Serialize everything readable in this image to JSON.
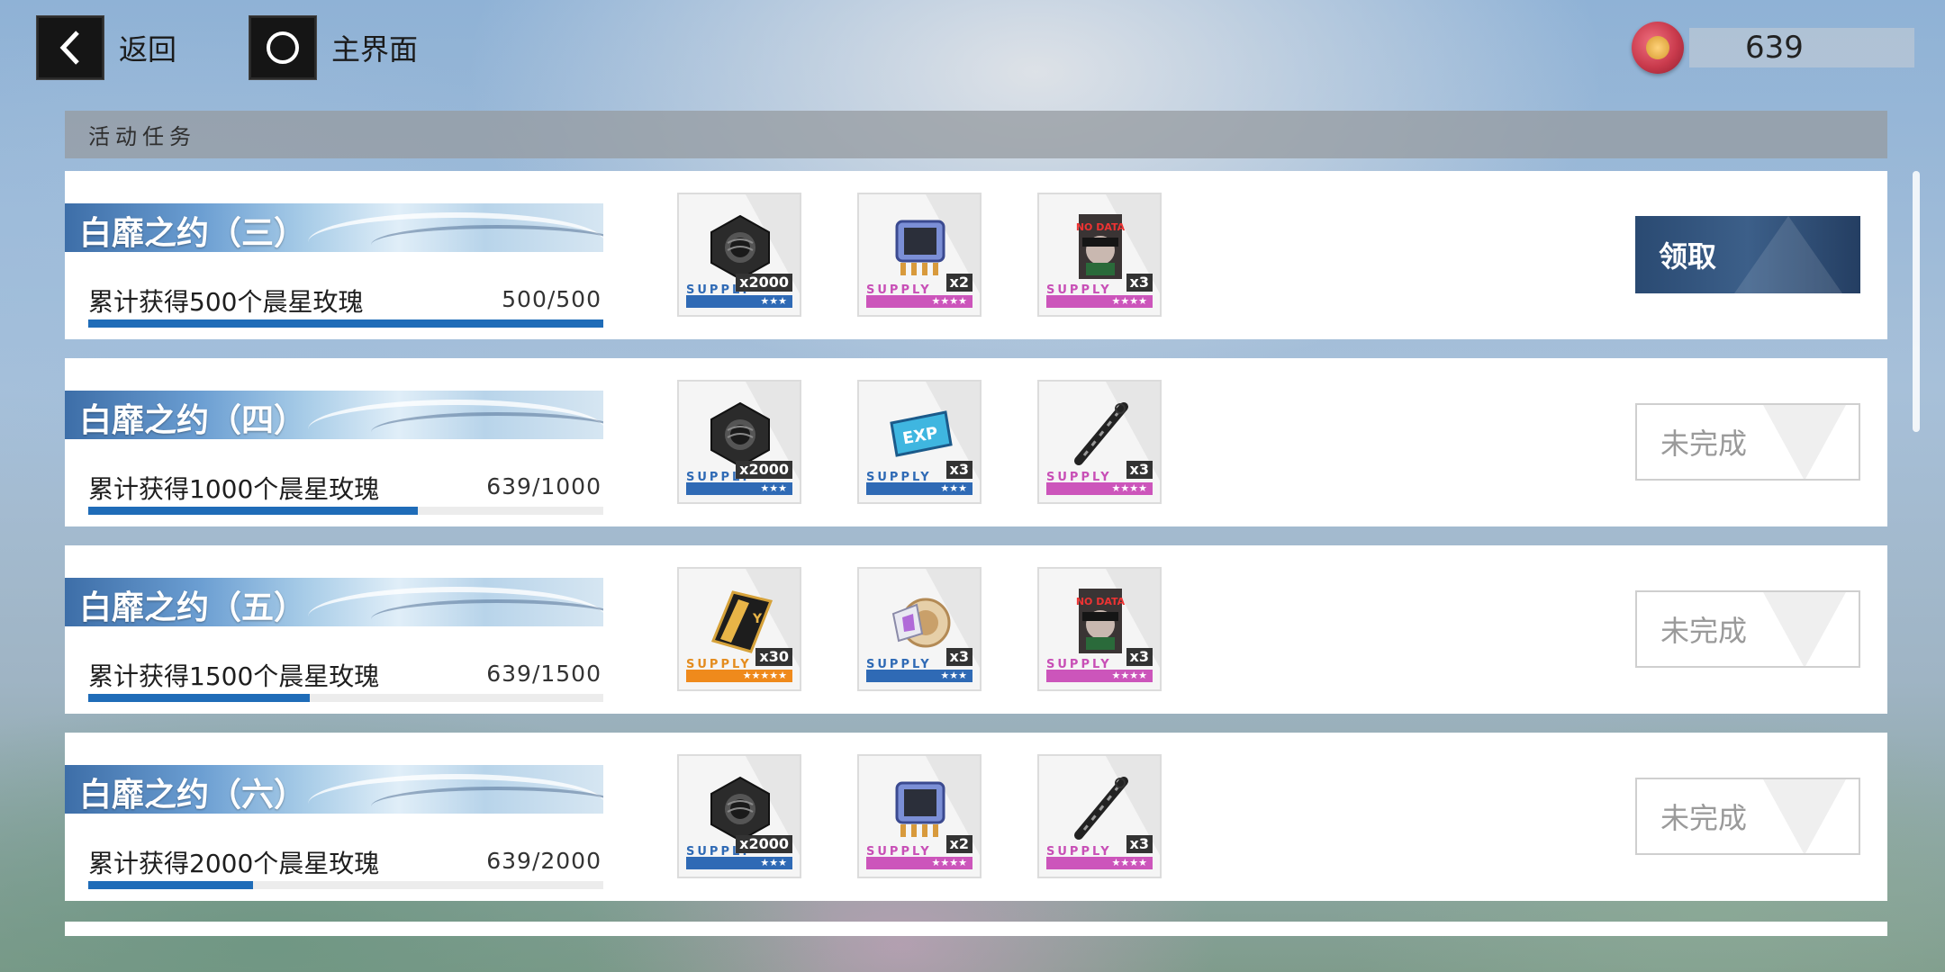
{
  "nav": {
    "back_label": "返回",
    "home_label": "主界面"
  },
  "currency": {
    "value": "639",
    "icon": "wax-seal-rose-icon"
  },
  "section": {
    "title": "活动任务"
  },
  "tasks": [
    {
      "title": "白靡之约（三）",
      "description": "累计获得500个晨星玫瑰",
      "progress_text": "500/500",
      "progress": 1.0,
      "status": "领取",
      "rewards": [
        {
          "icon": "hex-nut-icon",
          "supply": "SUPPLY",
          "qty": "x2000",
          "rarity": "★★★",
          "tier": "blue"
        },
        {
          "icon": "chip-icon",
          "supply": "SUPPLY",
          "qty": "x2",
          "rarity": "★★★★",
          "tier": "pink"
        },
        {
          "icon": "no-data-card-icon",
          "supply": "SUPPLY",
          "qty": "x3",
          "rarity": "★★★★",
          "tier": "pink"
        }
      ]
    },
    {
      "title": "白靡之约（四）",
      "description": "累计获得1000个晨星玫瑰",
      "progress_text": "639/1000",
      "progress": 0.639,
      "status": "未完成",
      "rewards": [
        {
          "icon": "hex-nut-icon",
          "supply": "SUPPLY",
          "qty": "x2000",
          "rarity": "★★★",
          "tier": "blue"
        },
        {
          "icon": "exp-ticket-icon",
          "supply": "SUPPLY",
          "qty": "x3",
          "rarity": "★★★",
          "tier": "blue"
        },
        {
          "icon": "pen-icon",
          "supply": "SUPPLY",
          "qty": "x3",
          "rarity": "★★★★",
          "tier": "pink"
        }
      ]
    },
    {
      "title": "白靡之约（五）",
      "description": "累计获得1500个晨星玫瑰",
      "progress_text": "639/1500",
      "progress": 0.426,
      "status": "未完成",
      "rewards": [
        {
          "icon": "gold-card-icon",
          "supply": "SUPPLY",
          "qty": "x30",
          "rarity": "★★★★★",
          "tier": "orange"
        },
        {
          "icon": "core-device-icon",
          "supply": "SUPPLY",
          "qty": "x3",
          "rarity": "★★★",
          "tier": "blue"
        },
        {
          "icon": "no-data-card-icon",
          "supply": "SUPPLY",
          "qty": "x3",
          "rarity": "★★★★",
          "tier": "pink"
        }
      ]
    },
    {
      "title": "白靡之约（六）",
      "description": "累计获得2000个晨星玫瑰",
      "progress_text": "639/2000",
      "progress": 0.3195,
      "status": "未完成",
      "rewards": [
        {
          "icon": "hex-nut-icon",
          "supply": "SUPPLY",
          "qty": "x2000",
          "rarity": "★★★",
          "tier": "blue"
        },
        {
          "icon": "chip-icon",
          "supply": "SUPPLY",
          "qty": "x2",
          "rarity": "★★★★",
          "tier": "pink"
        },
        {
          "icon": "pen-icon",
          "supply": "SUPPLY",
          "qty": "x3",
          "rarity": "★★★★",
          "tier": "pink"
        }
      ]
    }
  ]
}
